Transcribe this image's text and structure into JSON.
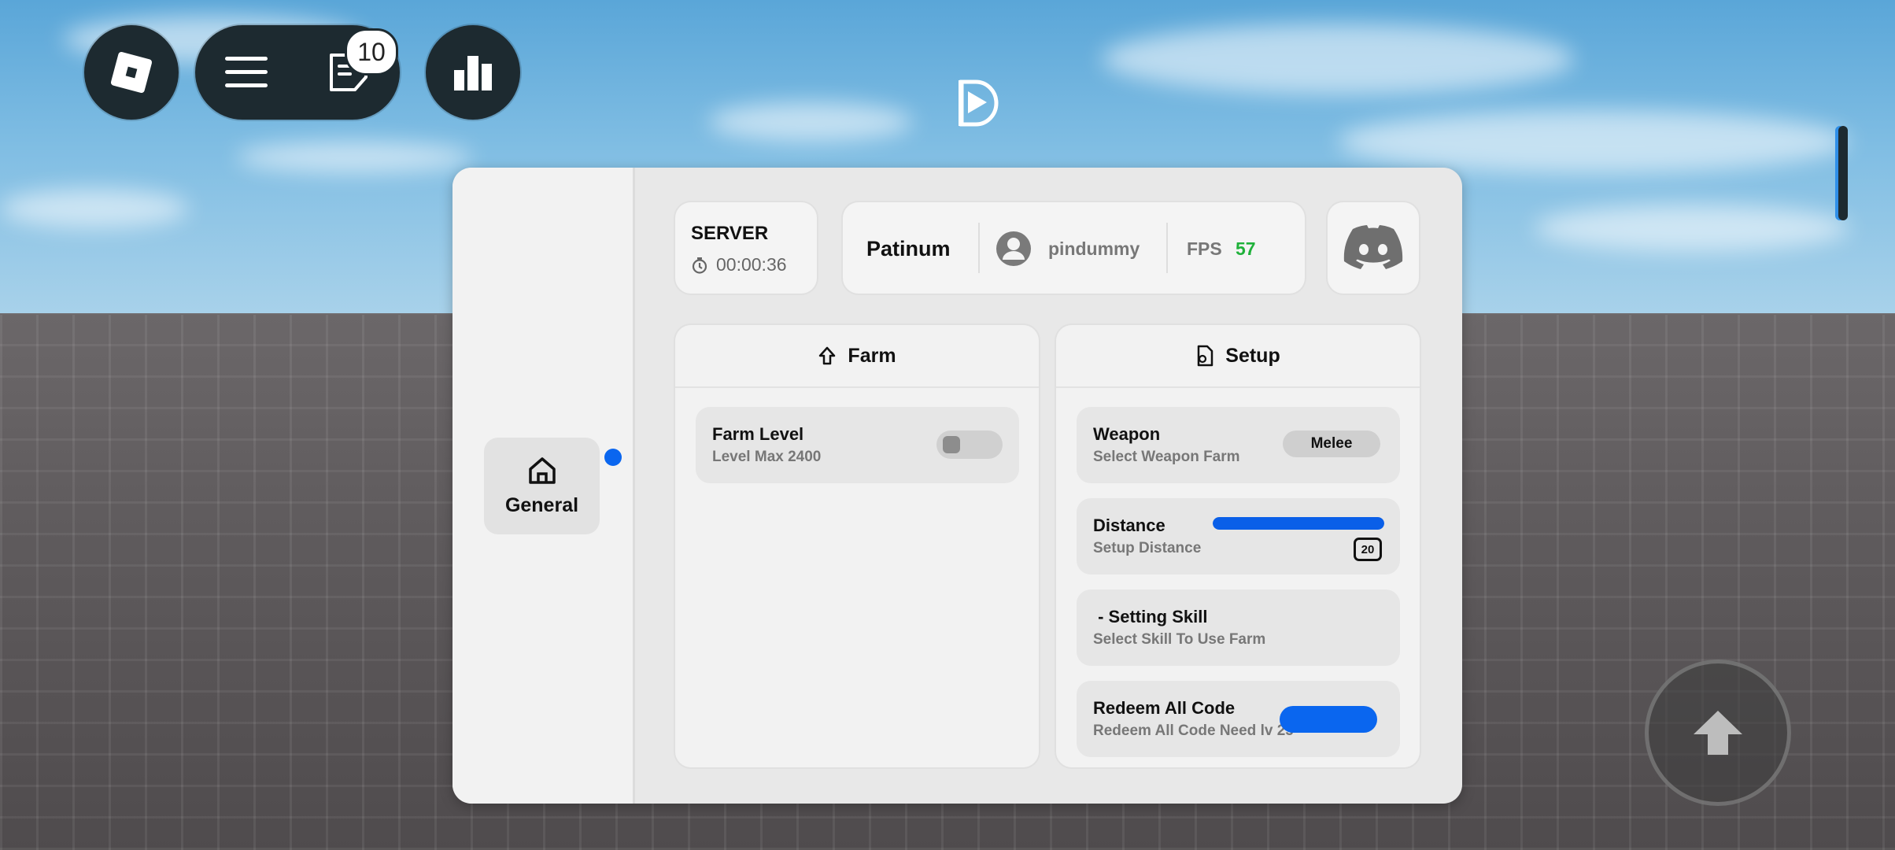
{
  "topbar": {
    "roblox_icon": "roblox-logo-icon",
    "menu_icon": "hamburger-menu-icon",
    "chat_icon": "chat-icon",
    "chat_badge": "10",
    "leaderboard_icon": "leaderboard-icon"
  },
  "sidebar": {
    "items": [
      {
        "label": "General",
        "icon": "home-icon",
        "active": true
      }
    ]
  },
  "server": {
    "title": "SERVER",
    "uptime": "00:00:36"
  },
  "info": {
    "name": "Patinum",
    "username": "pindummy",
    "fps_label": "FPS",
    "fps_value": "57"
  },
  "farm": {
    "title": "Farm",
    "items": [
      {
        "title": "Farm Level",
        "subtitle": "Level Max 2400",
        "toggle": false
      }
    ]
  },
  "setup": {
    "title": "Setup",
    "weapon": {
      "title": "Weapon",
      "subtitle": "Select Weapon Farm",
      "value": "Melee"
    },
    "distance": {
      "title": "Distance",
      "subtitle": "Setup Distance",
      "value": "20",
      "fill_fraction": 1.0
    },
    "skill": {
      "title": " - Setting Skill",
      "subtitle": "Select Skill To Use Farm"
    },
    "redeem": {
      "title": "Redeem All Code",
      "subtitle": "Redeem All Code Need lv 25"
    }
  },
  "colors": {
    "accent": "#0a66ef",
    "fps": "#1fb13a",
    "topbar_btn": "#1d2a30"
  }
}
